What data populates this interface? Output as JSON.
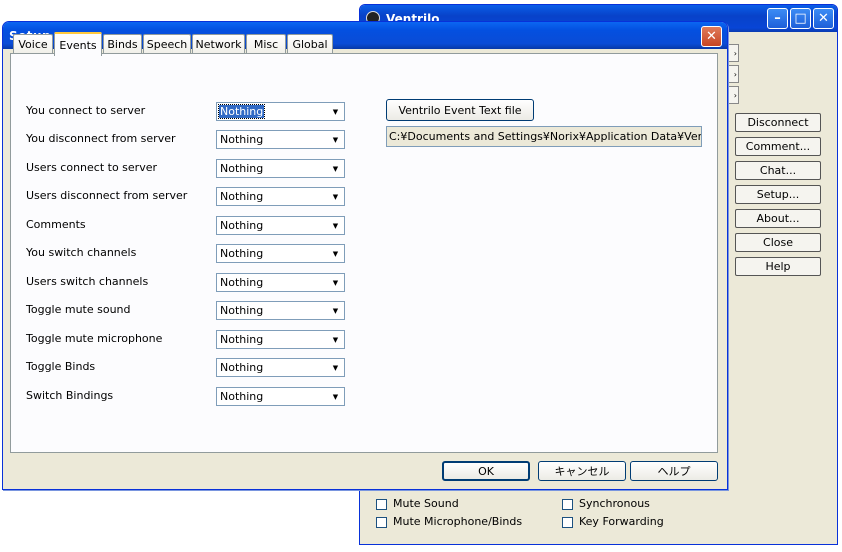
{
  "ventrilo": {
    "title": "Ventrilo",
    "buttons": [
      "Disconnect",
      "Comment...",
      "Chat...",
      "Setup...",
      "About...",
      "Close",
      "Help"
    ],
    "checkboxes": {
      "mute_sound": "Mute Sound",
      "mute_microphone": "Mute Microphone/Binds",
      "synchronous": "Synchronous",
      "key_forwarding": "Key Forwarding"
    }
  },
  "setup": {
    "title": "Setup",
    "tabs": [
      "Voice",
      "Events",
      "Binds",
      "Speech",
      "Network",
      "Misc",
      "Global"
    ],
    "active_tab": "Events",
    "events": [
      {
        "label": "You connect to server",
        "value": "Nothing"
      },
      {
        "label": "You disconnect from server",
        "value": "Nothing"
      },
      {
        "label": "Users connect to server",
        "value": "Nothing"
      },
      {
        "label": "Users disconnect from server",
        "value": "Nothing"
      },
      {
        "label": "Comments",
        "value": "Nothing"
      },
      {
        "label": "You switch channels",
        "value": "Nothing"
      },
      {
        "label": "Users switch channels",
        "value": "Nothing"
      },
      {
        "label": "Toggle mute sound",
        "value": "Nothing"
      },
      {
        "label": "Toggle mute microphone",
        "value": "Nothing"
      },
      {
        "label": "Toggle Binds",
        "value": "Nothing"
      },
      {
        "label": "Switch Bindings",
        "value": "Nothing"
      }
    ],
    "event_text_file_button": "Ventrilo Event Text file",
    "event_text_file_path": "C:¥Documents and Settings¥Norix¥Application Data¥Ventrilo",
    "ok": "OK",
    "cancel": "キャンセル",
    "help": "ヘルプ"
  }
}
